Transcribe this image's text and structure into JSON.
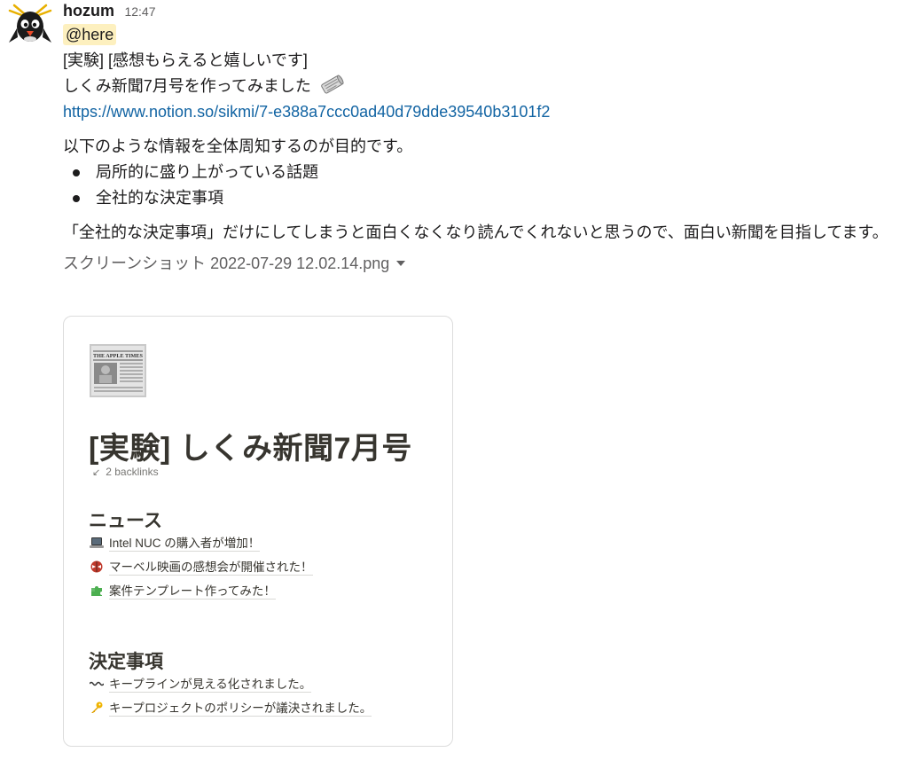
{
  "message": {
    "author": "hozum",
    "time": "12:47",
    "mention": "@here",
    "lines": [
      "[実験] [感想もらえると嬉しいです]",
      "しくみ新聞7月号を作ってみました"
    ],
    "link": "https://www.notion.so/sikmi/7-e388a7ccc0ad40d79dde39540b3101f2",
    "intro": "以下のような情報を全体周知するのが目的です。",
    "bullets": [
      "局所的に盛り上がっている話題",
      "全社的な決定事項"
    ],
    "closing": "「全社的な決定事項」だけにしてしまうと面白くなくなり読んでくれないと思うので、面白い新聞を目指してます。"
  },
  "attachment": {
    "file_name": "スクリーンショット 2022-07-29 12.02.14.png",
    "preview": {
      "newspaper_text": "THE APPLE TIMES",
      "title": "[実験] しくみ新聞7月号",
      "backlinks": "2 backlinks",
      "sections": [
        {
          "heading": "ニュース",
          "items": [
            {
              "icon": "laptop-icon",
              "text": "Intel NUC の購入者が増加！"
            },
            {
              "icon": "spider-icon",
              "text": "マーベル映画の感想会が開催された！"
            },
            {
              "icon": "puzzle-icon",
              "text": "案件テンプレート作ってみた！"
            }
          ]
        },
        {
          "heading": "決定事項",
          "items": [
            {
              "icon": "wavy-dash-icon",
              "text": "キープラインが見える化されました。"
            },
            {
              "icon": "key-icon",
              "text": "キープロジェクトのポリシーが議決されました。"
            }
          ]
        }
      ]
    }
  },
  "colors": {
    "link": "#1264a3",
    "mention_bg": "#fdf0bf",
    "text": "#1d1c1d",
    "muted": "#616061"
  }
}
